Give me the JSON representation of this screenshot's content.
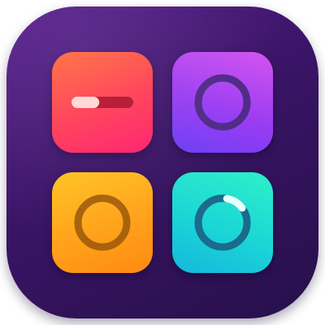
{
  "app_icon": {
    "icon_name": "app-icon",
    "pads": [
      {
        "name": "pad-top-left",
        "color": "#ff3b55",
        "glyph": "slider-icon",
        "slider_level": 0.45
      },
      {
        "name": "pad-top-right",
        "color": "#9a3cf2",
        "glyph": "ring-icon"
      },
      {
        "name": "pad-bottom-left",
        "color": "#ffa21a",
        "glyph": "ring-icon"
      },
      {
        "name": "pad-bottom-right",
        "color": "#1bd6d6",
        "glyph": "progress-ring-icon",
        "progress_level": 0.12
      }
    ]
  }
}
